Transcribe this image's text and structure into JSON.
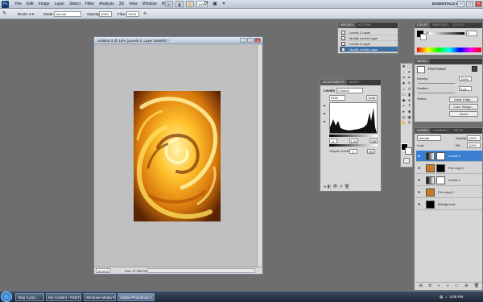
{
  "app": {
    "logo": "Ps",
    "menu": [
      "File",
      "Edit",
      "Image",
      "Layer",
      "Select",
      "Filter",
      "Analysis",
      "3D",
      "View",
      "Window",
      "Help"
    ],
    "zoom": "100%",
    "workspace": "ESSENTIALS ▾",
    "window_buttons": [
      "–",
      "□",
      "✕"
    ]
  },
  "options": {
    "brush_label": "Brush:",
    "mode_label": "Mode:",
    "mode_value": "Normal",
    "opacity_label": "Opacity:",
    "opacity_value": "100%",
    "flow_label": "Flow:",
    "flow_value": "100%"
  },
  "document": {
    "title": "Untitled-3 @ 15% (Levels 2, Layer Mask/8) *",
    "zoom_pct": "15.91%",
    "doc_size": "Doc: 17.2M/73.0M"
  },
  "history": {
    "tabs": [
      "History",
      "Actions"
    ],
    "rows": [
      "Levels 1 Layer",
      "Modify Levels Layer",
      "Levels 2 Layer",
      "Modify Levels Layer"
    ],
    "selected_index": 3
  },
  "adjustments": {
    "tabs": [
      "Adjustments",
      "Masks"
    ],
    "title": "Levels",
    "preset": "Custom",
    "channel": "RGB",
    "auto": "Auto",
    "input_levels": [
      "0",
      "1.00",
      "255"
    ],
    "output_label": "Output Levels:",
    "output_levels": [
      "0",
      "255"
    ]
  },
  "color": {
    "tabs": [
      "Color",
      "Swatches",
      "Styles"
    ],
    "channel": "K",
    "value": "0"
  },
  "masks": {
    "tabs": [
      "Masks"
    ],
    "title": "Pixel Mask",
    "density_label": "Density:",
    "density_value": "100%",
    "feather_label": "Feather:",
    "feather_value": "0 px",
    "refine_label": "Refine:",
    "buttons": [
      "Mask Edge...",
      "Color Range...",
      "Invert"
    ]
  },
  "layers": {
    "tabs": [
      "Layers",
      "Channels",
      "Paths"
    ],
    "blend": "Normal",
    "opacity_label": "Opacity:",
    "opacity_value": "100%",
    "lock_label": "Lock:",
    "fill_label": "Fill:",
    "fill_value": "100%",
    "items": [
      {
        "name": "Levels 2",
        "selected": true,
        "thumb": "#ffffff",
        "mask": "#ffffff"
      },
      {
        "name": "Fire copy 2",
        "selected": false,
        "thumb": "#c97a1e",
        "mask": "#000000"
      },
      {
        "name": "Levels 1",
        "selected": false,
        "thumb": "#ffffff",
        "mask": "#ffffff"
      },
      {
        "name": "Fire copy 2",
        "selected": false,
        "thumb": "#c97a1e",
        "mask": ""
      },
      {
        "name": "Background",
        "selected": false,
        "thumb": "#000000",
        "mask": ""
      }
    ],
    "footer": [
      "⊕",
      "fx",
      "◐",
      "◑",
      "▭",
      "⊞",
      "🗑"
    ]
  },
  "taskbar": {
    "items": [
      "Step 3.psd...",
      "My Content - PSDTu...",
      "Windows Media Player",
      "Adobe Photoshop C..."
    ],
    "active_index": 3,
    "clock": "2:06 PM"
  }
}
